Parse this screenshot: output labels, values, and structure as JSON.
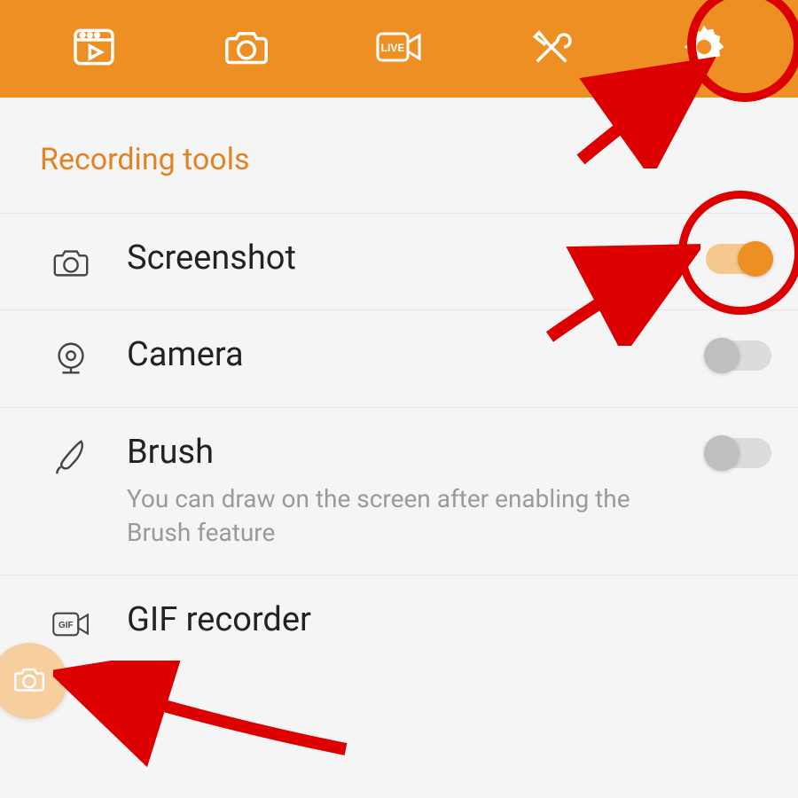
{
  "topbar": {
    "tabs": [
      {
        "name": "videos-tab",
        "icon": "video-clip-icon"
      },
      {
        "name": "photos-tab",
        "icon": "camera-icon"
      },
      {
        "name": "live-tab",
        "icon": "live-camera-icon"
      },
      {
        "name": "tools-tab",
        "icon": "tools-icon"
      },
      {
        "name": "settings-tab",
        "icon": "gear-icon",
        "selected": true
      }
    ]
  },
  "section_title": "Recording tools",
  "items": [
    {
      "icon": "camera-outline-icon",
      "label": "Screenshot",
      "toggle": "on",
      "sub": ""
    },
    {
      "icon": "webcam-icon",
      "label": "Camera",
      "toggle": "off",
      "sub": ""
    },
    {
      "icon": "brush-icon",
      "label": "Brush",
      "toggle": "off",
      "sub": "You can draw on the screen after enabling the Brush feature"
    },
    {
      "icon": "gif-icon",
      "label": "GIF recorder",
      "toggle": "",
      "sub": ""
    }
  ],
  "float_button": {
    "icon": "camera-icon"
  },
  "annotations": {
    "highlighted_tab": "settings-tab",
    "highlighted_toggle_item": "Screenshot",
    "arrow_targets": [
      "settings-tab",
      "Screenshot toggle",
      "floating camera button"
    ]
  },
  "colors": {
    "accent": "#ed8f23",
    "annotation": "#d00"
  }
}
